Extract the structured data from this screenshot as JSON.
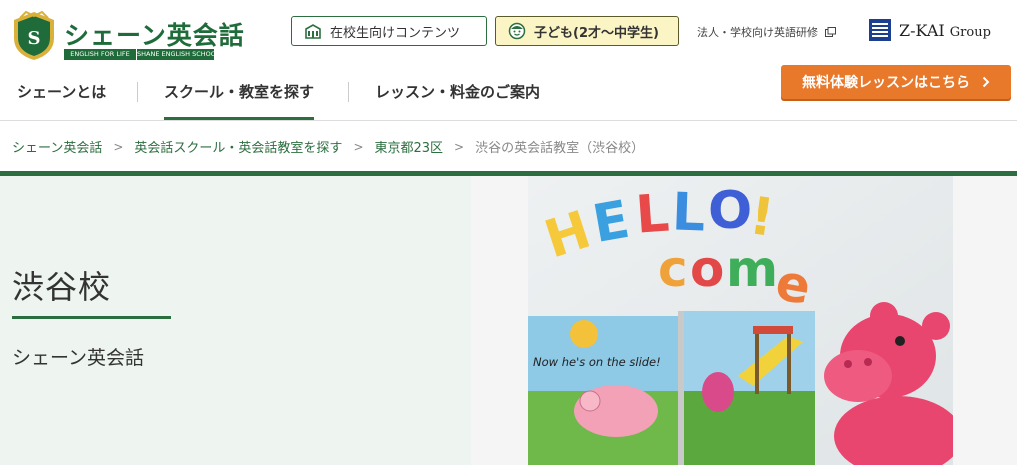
{
  "header": {
    "logo": {
      "name": "シェーン英会話",
      "tagline_left": "ENGLISH FOR LIFE",
      "tagline_right": "SHANE ENGLISH SCHOOL"
    },
    "utility": {
      "students_button": "在校生向けコンテンツ",
      "kids_button": "子ども(2才〜中学生)",
      "corporate_link": "法人・学校向け英語研修"
    },
    "group_logo": {
      "main": "Z-KAI",
      "sub": "Group"
    }
  },
  "nav": {
    "items": [
      {
        "label": "シェーンとは"
      },
      {
        "label": "スクール・教室を探す"
      },
      {
        "label": "レッスン・料金のご案内"
      }
    ],
    "cta": "無料体験レッスンはこちら"
  },
  "breadcrumb": {
    "items": [
      {
        "label": "シェーン英会話"
      },
      {
        "label": "英会話スクール・英会話教室を探す"
      },
      {
        "label": "東京都23区"
      }
    ],
    "current": "渋谷の英会話教室（渋谷校）"
  },
  "hero": {
    "school_name": "渋谷校",
    "brand": "シェーン英会話",
    "photo": {
      "letters_row1": "HELLO!",
      "letters_row2": "come",
      "book_text": "Now he's on the slide!"
    }
  },
  "colors": {
    "brand_green": "#2c6e3f",
    "cta_orange": "#e8782a",
    "kids_yellow": "#fbf4c5",
    "hero_bg": "#eef5f0"
  },
  "icons": [
    "shield-emblem-icon",
    "school-building-icon",
    "child-face-icon",
    "external-link-icon",
    "chevron-right-icon",
    "zkai-logo-icon"
  ]
}
